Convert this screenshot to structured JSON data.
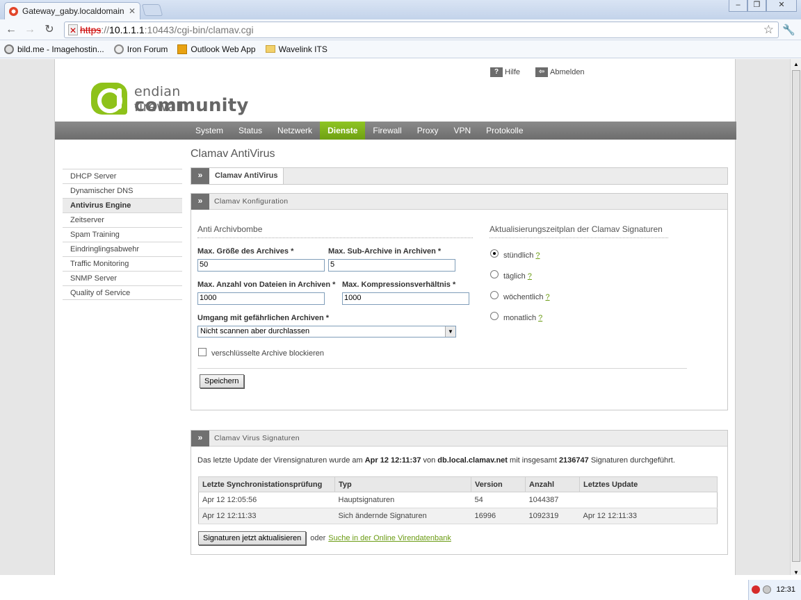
{
  "browser": {
    "tab_title": "Gateway_gaby.localdomain - E",
    "url_proto": "https",
    "url_rest_pre": "://",
    "url_host": "10.1.1.1",
    "url_path": ":10443/cgi-bin/clamav.cgi",
    "bookmarks": [
      {
        "label": "bild.me - Imagehostin..."
      },
      {
        "label": "Iron Forum"
      },
      {
        "label": "Outlook Web App"
      },
      {
        "label": "Wavelink ITS"
      }
    ]
  },
  "header": {
    "logo_line1": "endian firewall",
    "logo_line2": "community",
    "help_label": "Hilfe",
    "logout_label": "Abmelden"
  },
  "mainnav": [
    "System",
    "Status",
    "Netzwerk",
    "Dienste",
    "Firewall",
    "Proxy",
    "VPN",
    "Protokolle"
  ],
  "page_title": "Clamav AntiVirus",
  "sidenav": [
    "DHCP Server",
    "Dynamischer DNS",
    "Antivirus Engine",
    "Zeitserver",
    "Spam Training",
    "Eindringlingsabwehr",
    "Traffic Monitoring",
    "SNMP Server",
    "Quality of Service"
  ],
  "tab_label": "Clamav AntiVirus",
  "config": {
    "box_title": "Clamav Konfiguration",
    "archive_section": "Anti Archivbombe",
    "max_size_label": "Max. Größe des Archives *",
    "max_size_value": "50",
    "max_sub_label": "Max. Sub-Archive in Archiven *",
    "max_sub_value": "5",
    "max_files_label": "Max. Anzahl von Dateien in Archiven *",
    "max_files_value": "1000",
    "max_ratio_label": "Max. Kompressionsverhältnis *",
    "max_ratio_value": "1000",
    "handling_label": "Umgang mit gefährlichen Archiven *",
    "handling_value": "Nicht scannen aber durchlassen",
    "encrypted_label": "verschlüsselte Archive blockieren",
    "save_label": "Speichern",
    "schedule_section": "Aktualisierungszeitplan der Clamav Signaturen",
    "schedule_options": [
      "stündlich",
      "täglich",
      "wöchentlich",
      "monatlich"
    ],
    "help_mark": "?"
  },
  "signatures": {
    "box_title": "Clamav Virus Signaturen",
    "info_pre": "Das letzte Update der Virensignaturen wurde am ",
    "info_date": "Apr 12 12:11:37",
    "info_mid": " von ",
    "info_host": "db.local.clamav.net",
    "info_mid2": " mit insgesamt ",
    "info_count": "2136747",
    "info_post": " Signaturen durchgeführt.",
    "columns": [
      "Letzte Synchronistationsprüfung",
      "Typ",
      "Version",
      "Anzahl",
      "Letztes Update"
    ],
    "rows": [
      [
        "Apr 12 12:05:56",
        "Hauptsignaturen",
        "54",
        "1044387",
        ""
      ],
      [
        "Apr 12 12:11:33",
        "Sich ändernde Signaturen",
        "16996",
        "1092319",
        "Apr 12 12:11:33"
      ]
    ],
    "update_label": "Signaturen jetzt aktualisieren",
    "or_label": "oder",
    "search_link": "Suche in der Online Virendatenbank"
  },
  "tray": {
    "time": "12:31"
  }
}
